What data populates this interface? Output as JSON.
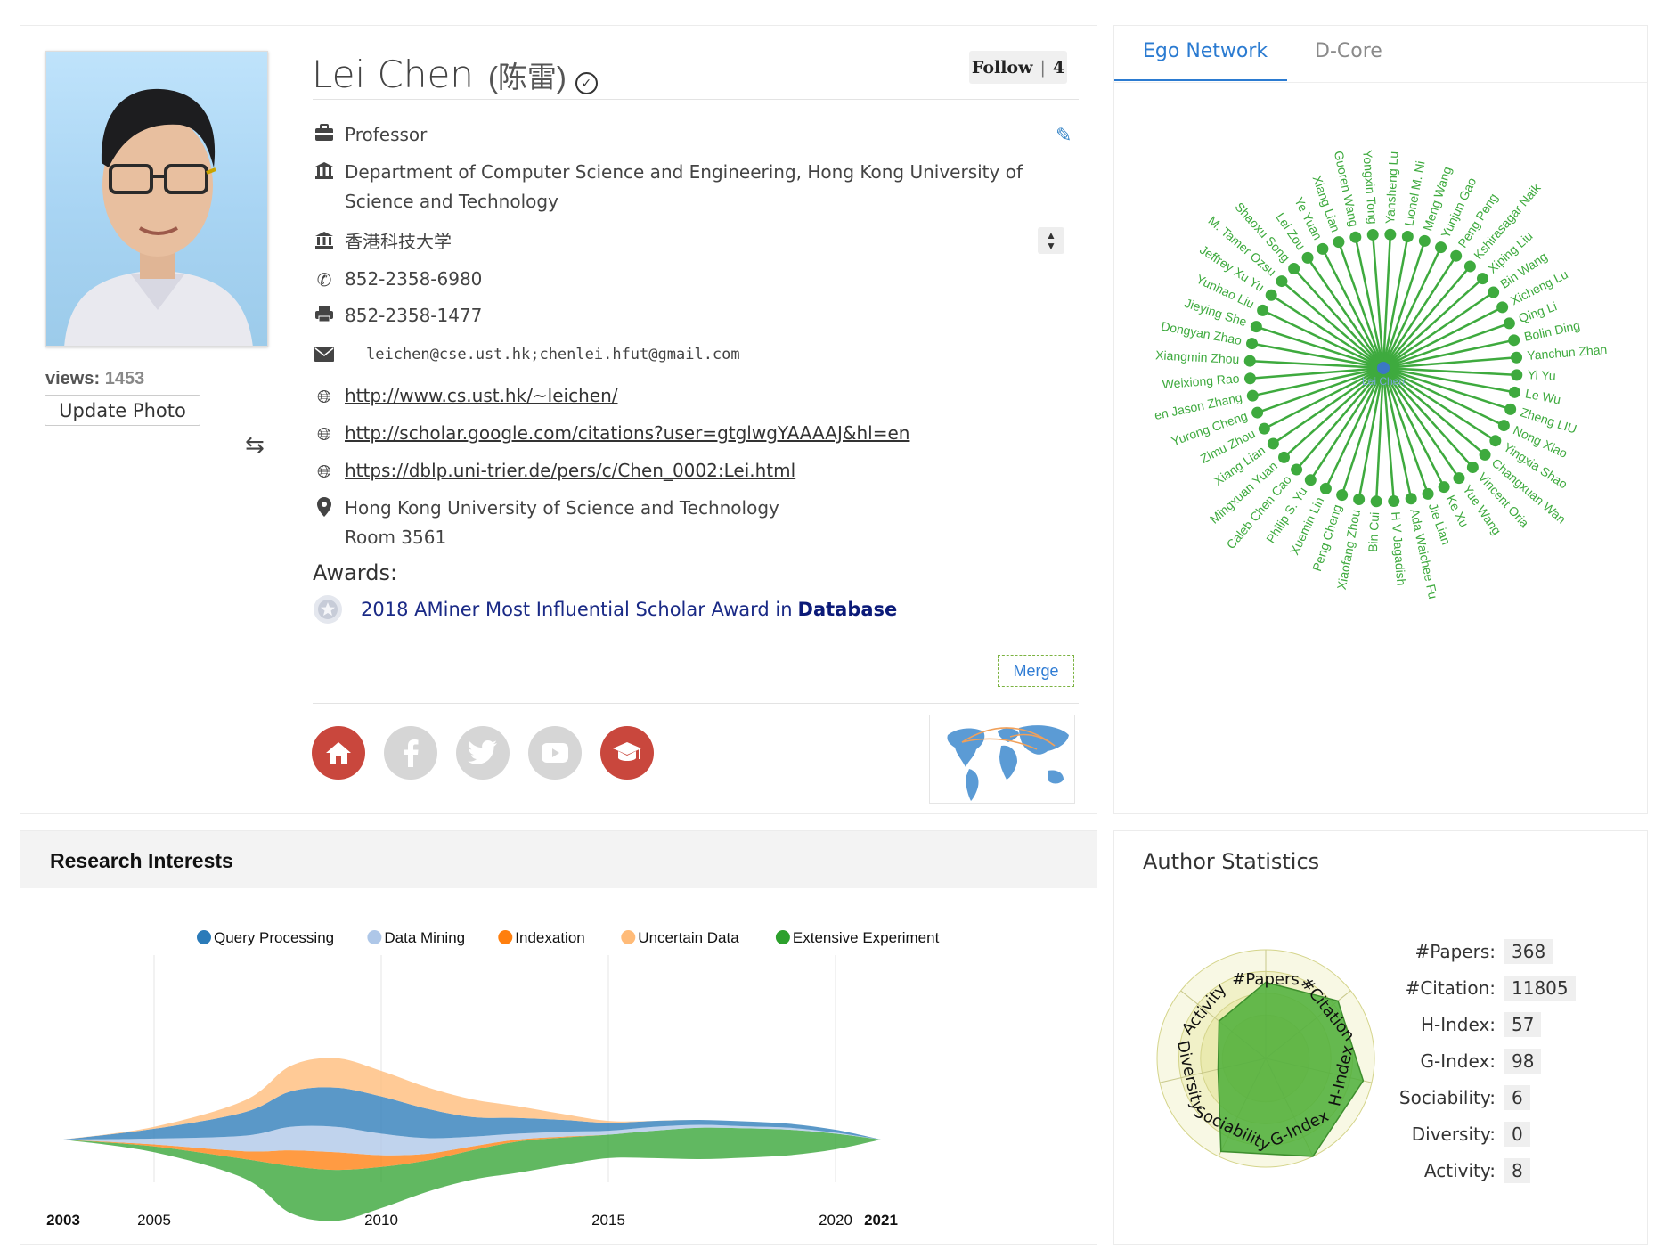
{
  "profile": {
    "name": "Lei Chen",
    "name_cn": "(陈雷)",
    "verified_symbol": "✓",
    "follow_label": "Follow",
    "follow_count": "4",
    "views_label": "views:",
    "views_count": "1453",
    "update_photo_label": "Update Photo",
    "position": "Professor",
    "department_line1": "Department of Computer Science and Engineering, Hong Kong University of",
    "department_line2": "Science and Technology",
    "org_cn": "香港科技大学",
    "phone": "852-2358-6980",
    "fax": "852-2358-1477",
    "email": "leichen@cse.ust.hk;chenlei.hfut@gmail.com",
    "homepage": "http://www.cs.ust.hk/~leichen/",
    "scholar_url": "http://scholar.google.com/citations?user=gtglwgYAAAAJ&hl=en",
    "dblp_url": "https://dblp.uni-trier.de/pers/c/Chen_0002:Lei.html",
    "address_line1": "Hong Kong University of Science and Technology",
    "address_line2": "Room 3561",
    "awards_label": "Awards:",
    "award_text": "2018 AMiner Most Influential Scholar Award in",
    "award_field": "Database",
    "merge_label": "Merge"
  },
  "social": [
    {
      "name": "home-icon",
      "color": "#c9473d"
    },
    {
      "name": "facebook-icon",
      "color": "#d6d6d6"
    },
    {
      "name": "twitter-icon",
      "color": "#d6d6d6"
    },
    {
      "name": "youtube-icon",
      "color": "#d6d6d6"
    },
    {
      "name": "scholar-cap-icon",
      "color": "#c9473d"
    }
  ],
  "network": {
    "tabs": [
      "Ego Network",
      "D-Core"
    ],
    "center": "Lei Chen",
    "color": "#3eaa3e",
    "nodes": [
      "Yansheng Lu",
      "Lionel M. Ni",
      "Meng Wang",
      "Yunjun Gao",
      "Peng Peng",
      "Kshirasagar Naik",
      "Xiping Liu",
      "Bin Wang",
      "Xicheng Lu",
      "Qing Li",
      "Bolin Ding",
      "Yanchun Zhan",
      "Yi Yu",
      "Le Wu",
      "Zheng LIU",
      "Nong Xiao",
      "Yingxia Shao",
      "Changxuan Wan",
      "Vincent Oria",
      "Yue Wang",
      "Ke Xu",
      "Jie Lian",
      "Ada Waichee Fu",
      "H V Jagadish",
      "Bin Cui",
      "Xiaofang Zhou",
      "Peng Cheng",
      "Xuemin Lin",
      "Philip S. Yu",
      "Caleb Chen Cao",
      "Mingxuan Yuan",
      "Xiang Lian",
      "Zimu Zhou",
      "Yurong Cheng",
      "en Jason Zhang",
      "Weixiong Rao",
      "Xiangmin Zhou",
      "Dongyan Zhao",
      "Jieying She",
      "Yunhao Liu",
      "Jeffrey Xu Yu",
      "M. Tamer Ozsu",
      "Shaoxu Song",
      "Lei Zou",
      "Ye Yuan",
      "Xiang Lian",
      "Guoren Wang",
      "Yongxin Tong"
    ]
  },
  "research_interests": {
    "title": "Research Interests"
  },
  "chart_data": {
    "type": "area",
    "title": "Research Interests",
    "x": [
      2003,
      2005,
      2007,
      2008,
      2009,
      2010,
      2011,
      2012,
      2013,
      2014,
      2015,
      2016,
      2017,
      2018,
      2019,
      2020,
      2021
    ],
    "x_tick_labels": [
      "2003",
      "2005",
      "2010",
      "2015",
      "2020",
      "2021"
    ],
    "legend_position": "top",
    "series": [
      {
        "name": "Query Processing",
        "color": "#2b7bb9",
        "values": [
          0,
          0.5,
          1.2,
          1.8,
          2.0,
          1.9,
          1.5,
          1.0,
          0.8,
          0.6,
          0.4,
          0.3,
          0.25,
          0.25,
          0.2,
          0.15,
          0
        ]
      },
      {
        "name": "Data Mining",
        "color": "#aec7e8",
        "values": [
          0,
          0.3,
          0.8,
          1.2,
          1.3,
          1.1,
          0.8,
          0.5,
          0.3,
          0.25,
          0.2,
          0.2,
          0.15,
          0.1,
          0.1,
          0.05,
          0
        ]
      },
      {
        "name": "Indexation",
        "color": "#ff7f0e",
        "values": [
          0,
          0.1,
          0.4,
          0.8,
          0.9,
          0.6,
          0.35,
          0.2,
          0.1,
          0.05,
          0,
          0,
          0,
          0,
          0,
          0,
          0
        ]
      },
      {
        "name": "Uncertain Data",
        "color": "#ffbb78",
        "values": [
          0,
          0.1,
          0.6,
          1.3,
          1.5,
          1.3,
          1.1,
          0.9,
          0.6,
          0.3,
          0.1,
          0,
          0,
          0,
          0,
          0,
          0
        ]
      },
      {
        "name": "Extensive Experiment",
        "color": "#2ca02c",
        "values": [
          0,
          0.3,
          1.0,
          2.4,
          2.6,
          2.1,
          1.6,
          1.5,
          1.6,
          1.4,
          1.2,
          1.4,
          1.6,
          1.5,
          1.3,
          0.8,
          0
        ]
      }
    ]
  },
  "author_statistics": {
    "title": "Author Statistics",
    "axes": [
      "#Papers",
      "#Citation",
      "H-Index",
      "G-Index",
      "Sociability",
      "Diversity",
      "Activity"
    ],
    "radar_levels": [
      0.7,
      0.85,
      0.92,
      1.0,
      0.95,
      0.45,
      0.55
    ],
    "stats": [
      {
        "label": "#Papers:",
        "value": "368"
      },
      {
        "label": "#Citation:",
        "value": "11805"
      },
      {
        "label": "H-Index:",
        "value": "57"
      },
      {
        "label": "G-Index:",
        "value": "98"
      },
      {
        "label": "Sociability:",
        "value": "6"
      },
      {
        "label": "Diversity:",
        "value": "0"
      },
      {
        "label": "Activity:",
        "value": "8"
      }
    ]
  }
}
